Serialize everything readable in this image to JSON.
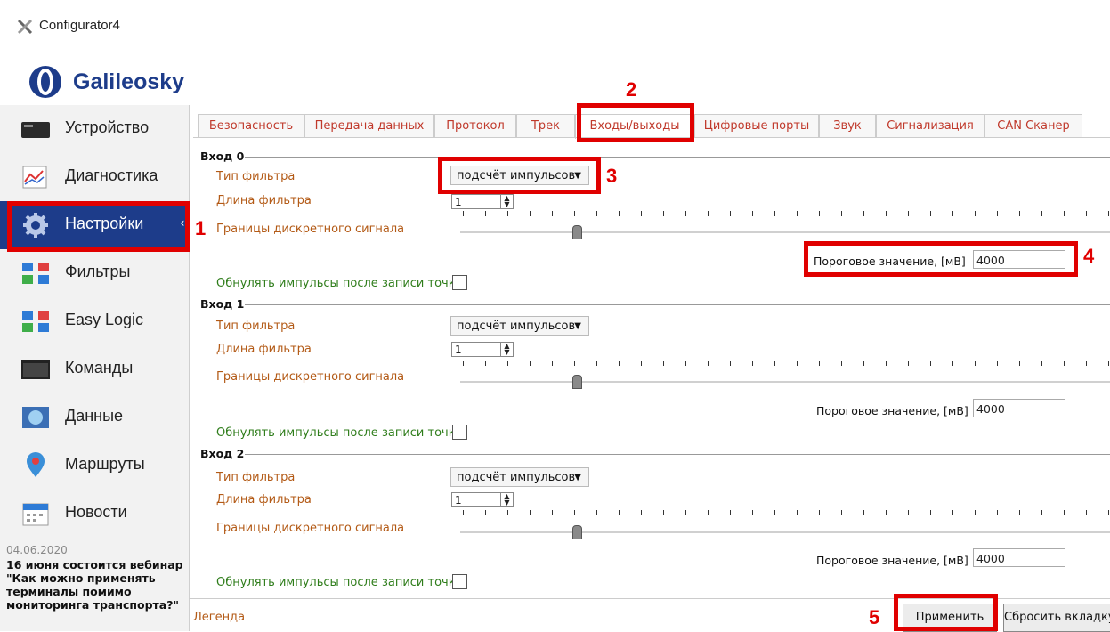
{
  "app": {
    "title": "Configurator4",
    "brand": "Galileosky"
  },
  "sidebar": {
    "items": [
      {
        "label": "Устройство",
        "icon": "device-icon"
      },
      {
        "label": "Диагностика",
        "icon": "diagnostics-chart-icon"
      },
      {
        "label": "Настройки",
        "icon": "gear-icon"
      },
      {
        "label": "Фильтры",
        "icon": "filters-icon"
      },
      {
        "label": "Easy Logic",
        "icon": "easy-logic-icon"
      },
      {
        "label": "Команды",
        "icon": "terminal-icon"
      },
      {
        "label": "Данные",
        "icon": "data-icon"
      },
      {
        "label": "Маршруты",
        "icon": "map-pin-icon"
      },
      {
        "label": "Новости",
        "icon": "calendar-icon"
      }
    ],
    "news": {
      "date": "04.06.2020",
      "text": "16 июня состоится вебинар \"Как можно применять терминалы помимо мониторинга транспорта?\""
    }
  },
  "tabs": [
    "Безопасность",
    "Передача данных",
    "Протокол",
    "Трек",
    "Входы/выходы",
    "Цифровые порты",
    "Звук",
    "Сигнализация",
    "CAN Сканер"
  ],
  "active_tab": "Входы/выходы",
  "inputs": [
    {
      "title": "Вход 0",
      "filter_type_label": "Тип фильтра",
      "filter_type": "подсчёт импульсов",
      "filter_length_label": "Длина фильтра",
      "filter_length": "1",
      "bounds_label": "Границы дискретного сигнала",
      "threshold_label": "Пороговое значение, [мВ]",
      "threshold": "4000",
      "reset_label": "Обнулять импульсы после записи точки"
    },
    {
      "title": "Вход 1",
      "filter_type_label": "Тип фильтра",
      "filter_type": "подсчёт импульсов",
      "filter_length_label": "Длина фильтра",
      "filter_length": "1",
      "bounds_label": "Границы дискретного сигнала",
      "threshold_label": "Пороговое значение, [мВ]",
      "threshold": "4000",
      "reset_label": "Обнулять импульсы после записи точки"
    },
    {
      "title": "Вход 2",
      "filter_type_label": "Тип фильтра",
      "filter_type": "подсчёт импульсов",
      "filter_length_label": "Длина фильтра",
      "filter_length": "1",
      "bounds_label": "Границы дискретного сигнала",
      "threshold_label": "Пороговое значение, [мВ]",
      "threshold": "4000",
      "reset_label": "Обнулять импульсы после записи точки"
    }
  ],
  "footer": {
    "legend": "Легенда",
    "apply": "Применить",
    "reset_tab": "Сбросить вкладку"
  },
  "annotations": [
    "1",
    "2",
    "3",
    "4",
    "5"
  ],
  "colors": {
    "accent": "#1d3c8a",
    "highlight": "#e00000",
    "label": "#b35a16",
    "green_label": "#2f7d1b"
  }
}
